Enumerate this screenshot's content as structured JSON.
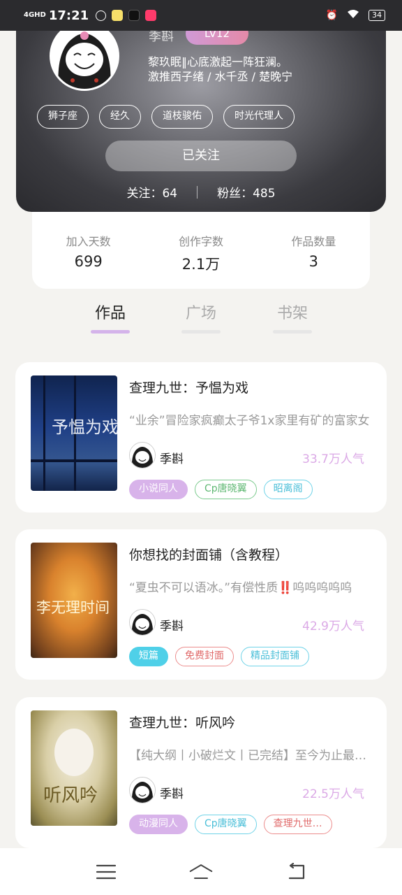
{
  "status_bar": {
    "network": "4GHD",
    "time": "17:21",
    "battery": "34"
  },
  "profile": {
    "username": "季斟",
    "level": "LV12",
    "bio_line1": "黎玖眠‖心底激起一阵狂澜。",
    "bio_line2": "激推西子绪 / 水千丞 / 楚晚宁",
    "tags": [
      "狮子座",
      "经久",
      "道枝骏佑",
      "时光代理人"
    ],
    "follow_button": "已关注",
    "following": "关注：64",
    "fans": "粉丝：485"
  },
  "stats": [
    {
      "label": "加入天数",
      "value": "699"
    },
    {
      "label": "创作字数",
      "value": "2.1万"
    },
    {
      "label": "作品数量",
      "value": "3"
    }
  ],
  "tabs": [
    {
      "label": "作品",
      "active": true
    },
    {
      "label": "广场",
      "active": false
    },
    {
      "label": "书架",
      "active": false
    }
  ],
  "works": [
    {
      "title": "查理九世：予愠为戏",
      "desc": "“业余”冒险家疯癫太子爷1x家里有矿的富家女",
      "author": "季斟",
      "popularity": "33.7万人气",
      "cover_text": "予愠为戏",
      "badges": [
        {
          "label": "小说同人",
          "style": "filled",
          "color": "#d8b3ea",
          "text_color": "#ffffff"
        },
        {
          "label": "Cp唐晓翼",
          "style": "outline",
          "color": "#7ccb8e",
          "text_color": "#5fb873"
        },
        {
          "label": "昭离阁",
          "style": "outline",
          "color": "#6fd3e8",
          "text_color": "#4bbfd8"
        }
      ]
    },
    {
      "title": "你想找的封面铺（含教程）",
      "desc": "“夏虫不可以语冰。”有偿性质‼️呜呜呜呜呜",
      "author": "季斟",
      "popularity": "42.9万人气",
      "cover_text": "李无理时间",
      "badges": [
        {
          "label": "短篇",
          "style": "filled",
          "color": "#4fd0e8",
          "text_color": "#ffffff"
        },
        {
          "label": "免费封面",
          "style": "outline",
          "color": "#ec8d8d",
          "text_color": "#e06a6a"
        },
        {
          "label": "精品封面铺",
          "style": "outline",
          "color": "#6fd3e8",
          "text_color": "#4bbfd8"
        }
      ]
    },
    {
      "title": "查理九世：听风吟",
      "desc": "【纯大纲丨小破烂文丨已完结】至今为止最满意的",
      "author": "季斟",
      "popularity": "22.5万人气",
      "cover_text": "听风吟",
      "badges": [
        {
          "label": "动漫同人",
          "style": "filled",
          "color": "#d8b3ea",
          "text_color": "#ffffff"
        },
        {
          "label": "Cp唐晓翼",
          "style": "outline",
          "color": "#6fd3e8",
          "text_color": "#4bbfd8"
        },
        {
          "label": "查理九世…",
          "style": "outline",
          "color": "#ec8d8d",
          "text_color": "#e06a6a"
        }
      ]
    }
  ],
  "nav": {
    "icons": [
      "menu-icon",
      "home-icon",
      "back-icon"
    ]
  }
}
